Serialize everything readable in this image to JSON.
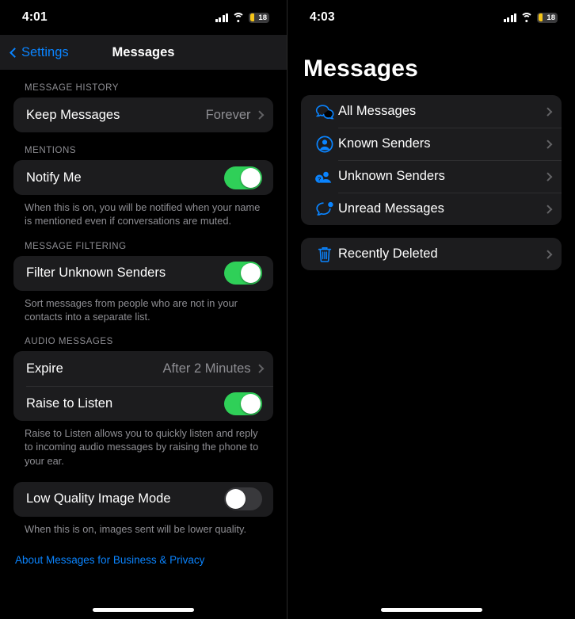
{
  "left": {
    "status": {
      "time": "4:01",
      "battery_level": "18",
      "battery_color": "#f5c518",
      "signal_icon": "cellular-signal-icon",
      "wifi_icon": "wifi-icon"
    },
    "nav": {
      "back_label": "Settings",
      "title": "Messages"
    },
    "sections": [
      {
        "header": "MESSAGE HISTORY",
        "rows": [
          {
            "type": "value",
            "label": "Keep Messages",
            "value": "Forever",
            "name": "keep-messages"
          }
        ],
        "footnote": ""
      },
      {
        "header": "MENTIONS",
        "rows": [
          {
            "type": "toggle",
            "label": "Notify Me",
            "state": "on",
            "name": "notify-me"
          }
        ],
        "footnote": "When this is on, you will be notified when your name is mentioned even if conversations are muted."
      },
      {
        "header": "MESSAGE FILTERING",
        "rows": [
          {
            "type": "toggle",
            "label": "Filter Unknown Senders",
            "state": "on",
            "name": "filter-unknown-senders"
          }
        ],
        "footnote": "Sort messages from people who are not in your contacts into a separate list."
      },
      {
        "header": "AUDIO MESSAGES",
        "rows": [
          {
            "type": "value",
            "label": "Expire",
            "value": "After 2 Minutes",
            "name": "expire"
          },
          {
            "type": "toggle",
            "label": "Raise to Listen",
            "state": "on",
            "name": "raise-to-listen"
          }
        ],
        "footnote": "Raise to Listen allows you to quickly listen and reply to incoming audio messages by raising the phone to your ear."
      },
      {
        "header": "",
        "rows": [
          {
            "type": "toggle",
            "label": "Low Quality Image Mode",
            "state": "off",
            "name": "low-quality-image-mode"
          }
        ],
        "footnote": "When this is on, images sent will be lower quality."
      }
    ],
    "link": "About Messages for Business & Privacy"
  },
  "right": {
    "status": {
      "time": "4:03",
      "battery_level": "18",
      "battery_color": "#f5c518",
      "signal_icon": "cellular-signal-icon",
      "wifi_icon": "wifi-icon"
    },
    "title": "Messages",
    "groups": [
      {
        "items": [
          {
            "label": "All Messages",
            "icon": "two-speech-bubbles-icon",
            "name": "all-messages"
          },
          {
            "label": "Known Senders",
            "icon": "person-circle-icon",
            "name": "known-senders"
          },
          {
            "label": "Unknown Senders",
            "icon": "person-question-icon",
            "name": "unknown-senders"
          },
          {
            "label": "Unread Messages",
            "icon": "bubble-badge-icon",
            "name": "unread-messages"
          }
        ]
      },
      {
        "items": [
          {
            "label": "Recently Deleted",
            "icon": "trash-icon",
            "name": "recently-deleted"
          }
        ]
      }
    ]
  },
  "colors": {
    "accent": "#0a84ff",
    "toggle_on": "#2fd058",
    "toggle_off": "#39393c",
    "card": "#1c1c1e",
    "section_header": "#8e8e93"
  }
}
